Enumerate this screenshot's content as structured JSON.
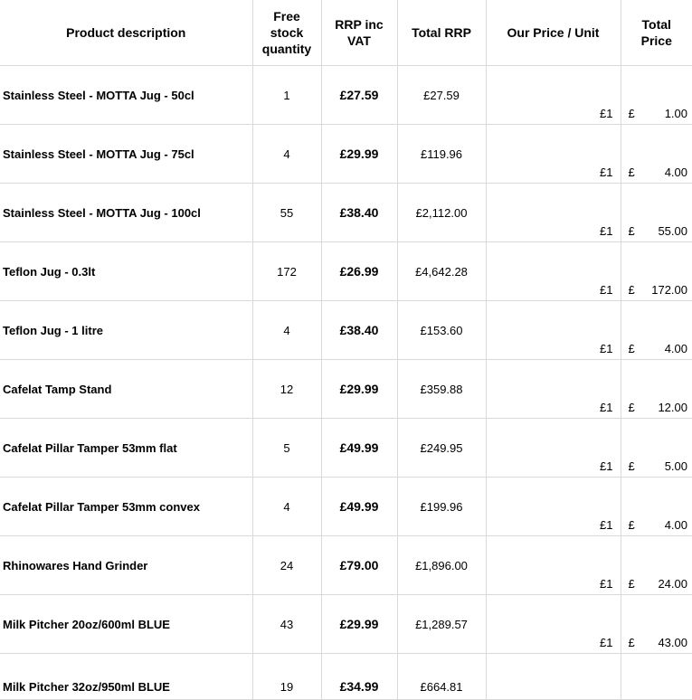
{
  "headers": {
    "product_description": "Product description",
    "free_stock_quantity": "Free stock quantity",
    "rrp_inc_vat": "RRP inc VAT",
    "total_rrp": "Total RRP",
    "our_price_unit": "Our Price / Unit",
    "total_price": "Total Price"
  },
  "rows": [
    {
      "description": "Stainless Steel - MOTTA Jug - 50cl",
      "qty": "1",
      "rrp": "£27.59",
      "total_rrp": "£27.59",
      "unit_price": "£1",
      "currency": "£",
      "total_price": "1.00"
    },
    {
      "description": "Stainless Steel - MOTTA Jug - 75cl",
      "qty": "4",
      "rrp": "£29.99",
      "total_rrp": "£119.96",
      "unit_price": "£1",
      "currency": "£",
      "total_price": "4.00"
    },
    {
      "description": "Stainless Steel - MOTTA Jug - 100cl",
      "qty": "55",
      "rrp": "£38.40",
      "total_rrp": "£2,112.00",
      "unit_price": "£1",
      "currency": "£",
      "total_price": "55.00"
    },
    {
      "description": "Teflon Jug - 0.3lt",
      "qty": "172",
      "rrp": "£26.99",
      "total_rrp": "£4,642.28",
      "unit_price": "£1",
      "currency": "£",
      "total_price": "172.00"
    },
    {
      "description": "Teflon Jug - 1 litre",
      "qty": "4",
      "rrp": "£38.40",
      "total_rrp": "£153.60",
      "unit_price": "£1",
      "currency": "£",
      "total_price": "4.00"
    },
    {
      "description": "Cafelat Tamp Stand",
      "qty": "12",
      "rrp": "£29.99",
      "total_rrp": "£359.88",
      "unit_price": "£1",
      "currency": "£",
      "total_price": "12.00"
    },
    {
      "description": "Cafelat Pillar Tamper 53mm flat",
      "qty": "5",
      "rrp": "£49.99",
      "total_rrp": "£249.95",
      "unit_price": "£1",
      "currency": "£",
      "total_price": "5.00"
    },
    {
      "description": "Cafelat Pillar Tamper 53mm convex",
      "qty": "4",
      "rrp": "£49.99",
      "total_rrp": "£199.96",
      "unit_price": "£1",
      "currency": "£",
      "total_price": "4.00"
    },
    {
      "description": "Rhinowares Hand Grinder",
      "qty": "24",
      "rrp": "£79.00",
      "total_rrp": "£1,896.00",
      "unit_price": "£1",
      "currency": "£",
      "total_price": "24.00"
    },
    {
      "description": "Milk Pitcher 20oz/600ml BLUE",
      "qty": "43",
      "rrp": "£29.99",
      "total_rrp": "£1,289.57",
      "unit_price": "£1",
      "currency": "£",
      "total_price": "43.00"
    },
    {
      "description": "Milk Pitcher 32oz/950ml BLUE",
      "qty": "19",
      "rrp": "£34.99",
      "total_rrp": "£664.81",
      "unit_price": "",
      "currency": "",
      "total_price": ""
    }
  ]
}
